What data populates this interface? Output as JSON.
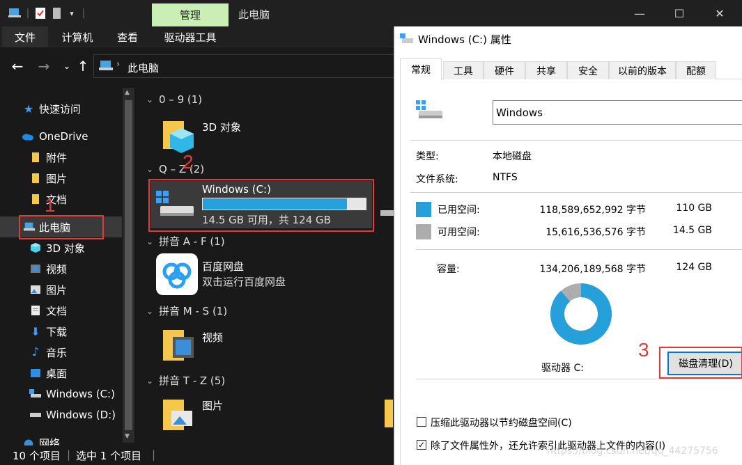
{
  "explorer": {
    "ribbon_context_tab": "管理",
    "window_title": "此电脑",
    "ribbon_tabs": [
      "文件",
      "计算机",
      "查看",
      "驱动器工具"
    ],
    "address": "此电脑",
    "nav": {
      "quick_access": "快速访问",
      "onedrive": "OneDrive",
      "onedrive_items": [
        "附件",
        "图片",
        "文档"
      ],
      "this_pc": "此电脑",
      "this_pc_items": [
        "3D 对象",
        "视频",
        "图片",
        "文档",
        "下载",
        "音乐",
        "桌面",
        "Windows (C:)",
        "Windows (D:)"
      ],
      "network": "网络"
    },
    "groups": {
      "g1": "0 – 9 (1)",
      "g2": "Q – Z (2)",
      "g3": "拼音 A - F (1)",
      "g4": "拼音 M - S (1)",
      "g5": "拼音 T - Z (5)"
    },
    "tiles": {
      "objects3d": "3D 对象",
      "drive_name": "Windows (C:)",
      "drive_free": "14.5 GB 可用，共 124 GB",
      "drive_used_fraction": 0.883,
      "baidu_name": "百度网盘",
      "baidu_sub": "双击运行百度网盘",
      "videos": "视频",
      "pictures": "图片"
    },
    "status": {
      "items": "10 个项目",
      "selected": "选中 1 个项目"
    },
    "annotations": [
      "1",
      "2",
      "3"
    ]
  },
  "dialog": {
    "title": "Windows (C:) 属性",
    "tabs": [
      "常规",
      "工具",
      "硬件",
      "共享",
      "安全",
      "以前的版本",
      "配额"
    ],
    "volume_name": "Windows",
    "type_label": "类型:",
    "type_value": "本地磁盘",
    "fs_label": "文件系统:",
    "fs_value": "NTFS",
    "used_label": "已用空间:",
    "used_bytes": "118,589,652,992 字节",
    "used_human": "110 GB",
    "free_label": "可用空间:",
    "free_bytes": "15,616,536,576 字节",
    "free_human": "14.5 GB",
    "capacity_label": "容量:",
    "capacity_bytes": "134,206,189,568 字节",
    "capacity_human": "124 GB",
    "drive_label": "驱动器 C:",
    "cleanup_button": "磁盘清理(D)",
    "compress_label": "压缩此驱动器以节约磁盘空间(C)",
    "index_label": "除了文件属性外，还允许索引此驱动器上文件的内容(I)",
    "compress_checked": false,
    "index_checked": true,
    "used_fraction": 0.884,
    "colors": {
      "used": "#26a0da",
      "free": "#adadad"
    }
  },
  "watermark": "https://blog.csdn.net/qq_44275756"
}
